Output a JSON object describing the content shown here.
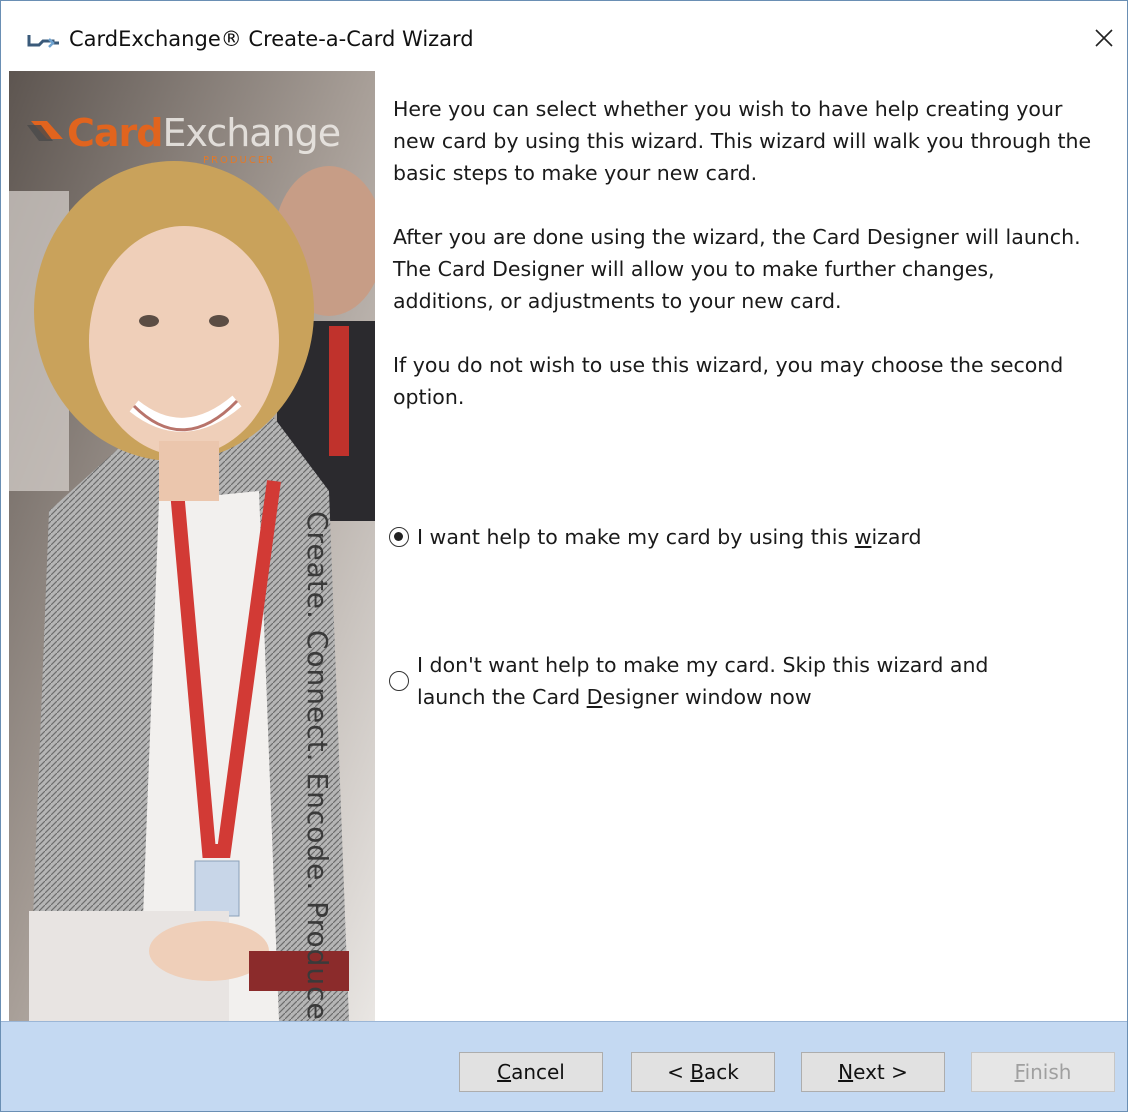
{
  "window": {
    "title": "CardExchange® Create-a-Card Wizard",
    "close_label": "✕"
  },
  "banner": {
    "logo_part1": "Card",
    "logo_part2": "Exchange",
    "logo_sub": "PRODUCER",
    "tagline": "Create. Connect. Encode. Produce"
  },
  "content": {
    "paragraphs": [
      "Here you can select whether you wish to have help creating your new card by using this wizard. This wizard will walk you through the basic steps to make your new card.",
      "After you are done using the wizard, the Card Designer will launch.  The Card Designer will allow you to make further changes, additions, or adjustments to your new card.",
      "If you do not wish to use this wizard, you may choose the second option."
    ],
    "options": [
      {
        "label_pre": "I want help to make my card by using this ",
        "label_ul": "w",
        "label_post": "izard",
        "checked": true
      },
      {
        "label_line1": "I don't want help to make my card. Skip this wizard and",
        "label_line2_pre": "launch the Card ",
        "label_line2_ul": "D",
        "label_line2_post": "esigner window now",
        "checked": false
      }
    ]
  },
  "buttons": {
    "cancel": {
      "ul": "C",
      "rest": "ancel",
      "disabled": false
    },
    "back": {
      "pre": "< ",
      "ul": "B",
      "rest": "ack",
      "disabled": false
    },
    "next": {
      "ul": "N",
      "rest": "ext >",
      "disabled": false
    },
    "finish": {
      "ul": "F",
      "rest": "inish",
      "disabled": true
    }
  },
  "colors": {
    "footer_bg": "#c4d9f2",
    "logo_orange": "#e1641e"
  }
}
